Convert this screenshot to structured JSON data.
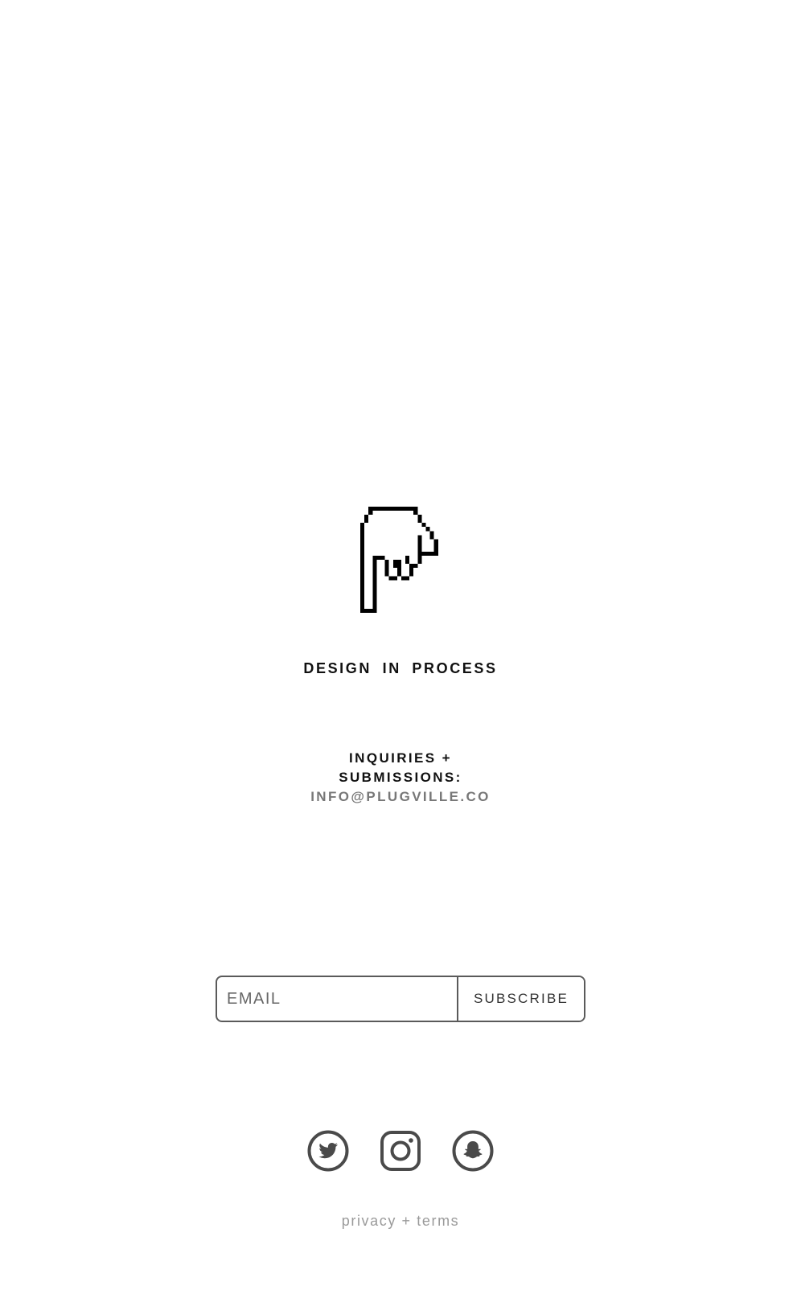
{
  "hero": {
    "icon": "pixel-hand-pointing-down-icon",
    "tagline": "DESIGN IN PROCESS"
  },
  "contact": {
    "line1": "INQUIRIES +",
    "line2": "SUBMISSIONS:",
    "email": "INFO@PLUGVILLE.CO"
  },
  "newsletter": {
    "placeholder": "EMAIL",
    "button_label": "SUBSCRIBE"
  },
  "social": {
    "items": [
      {
        "name": "Twitter",
        "icon": "twitter-icon"
      },
      {
        "name": "Instagram",
        "icon": "instagram-icon"
      },
      {
        "name": "Snapchat",
        "icon": "snapchat-icon"
      }
    ]
  },
  "footer": {
    "link_label": "privacy + terms"
  },
  "colors": {
    "text": "#111111",
    "email_link": "#777777",
    "icon": "#4a4a4a",
    "footer": "#9a9a9a",
    "border": "#5a5a5a"
  }
}
